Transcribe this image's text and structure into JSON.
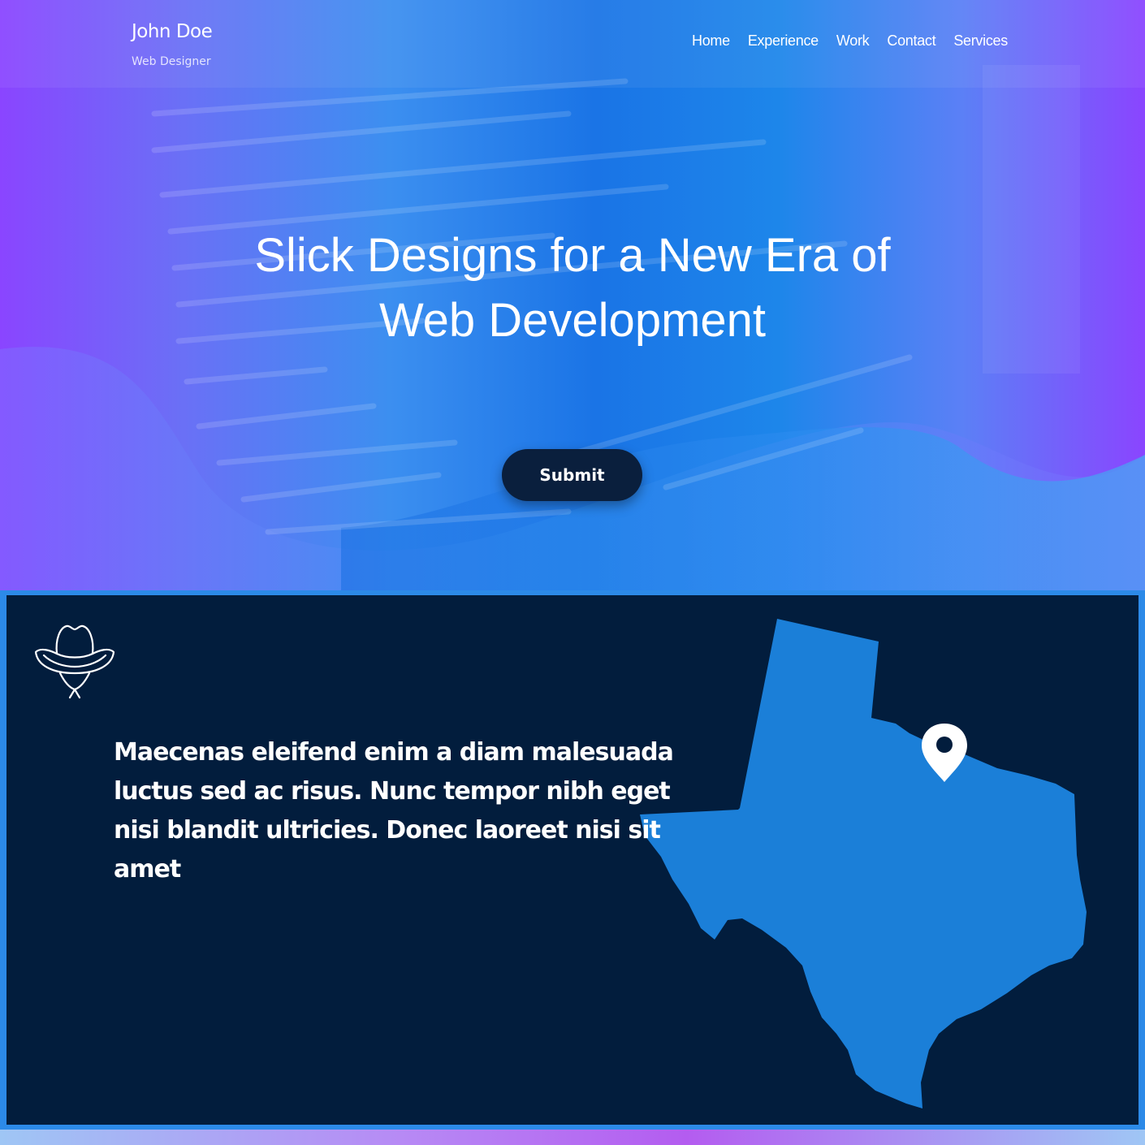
{
  "header": {
    "brand_name": "John Doe",
    "brand_subtitle": "Web Designer",
    "nav": [
      "Home",
      "Experience",
      "Work",
      "Contact",
      "Services"
    ]
  },
  "hero": {
    "title_line1": "Slick Designs for a New Era of",
    "title_line2": "Web Development",
    "submit_label": "Submit"
  },
  "content": {
    "paragraph": "Maecenas eleifend enim a diam malesuada luctus sed ac risus. Nunc tempor nibh eget nisi blandit ultricies. Donec laoreet nisi sit amet"
  },
  "icons": {
    "hat": "cowboy-hat-icon",
    "pin": "map-pin-icon"
  },
  "colors": {
    "dark_navy": "#021d3d",
    "map_blue": "#1b7fd8",
    "accent_purple": "#8a45ff",
    "button_navy": "#0a1f3d"
  }
}
